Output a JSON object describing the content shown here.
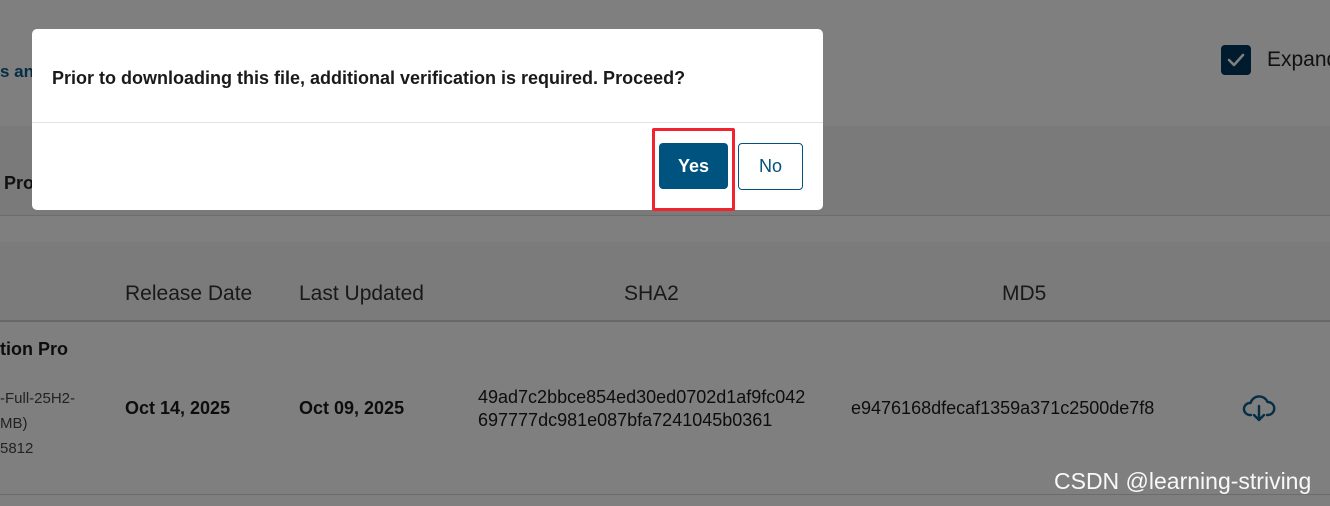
{
  "background": {
    "link_fragment": "s an",
    "expand_label": "Expand",
    "product_fragment": "Pro",
    "table": {
      "headers": {
        "release_date": "Release Date",
        "last_updated": "Last Updated",
        "sha2": "SHA2",
        "md5": "MD5"
      },
      "row": {
        "title_fragment": "tion Pro",
        "file_name_fragment": "-Full-25H2-",
        "file_size_fragment": " MB)",
        "file_id_fragment": "5812",
        "release_date": "Oct 14, 2025",
        "last_updated": "Oct 09, 2025",
        "sha2_line1": "49ad7c2bbce854ed30ed0702d1af9fc042",
        "sha2_line2": "697777dc981e087bfa7241045b0361",
        "md5": "e9476168dfecaf1359a371c2500de7f8",
        "download_icon": "cloud-download-icon"
      }
    }
  },
  "dialog": {
    "message": "Prior to downloading this file, additional verification is required. Proceed?",
    "yes_label": "Yes",
    "no_label": "No"
  },
  "annotation": {
    "highlight_color": "#f0242e"
  },
  "watermark": "CSDN @learning-striving",
  "colors": {
    "primary": "#00527f",
    "checkbox": "#00365a",
    "overlay": "rgba(0,0,0,0.5)"
  }
}
